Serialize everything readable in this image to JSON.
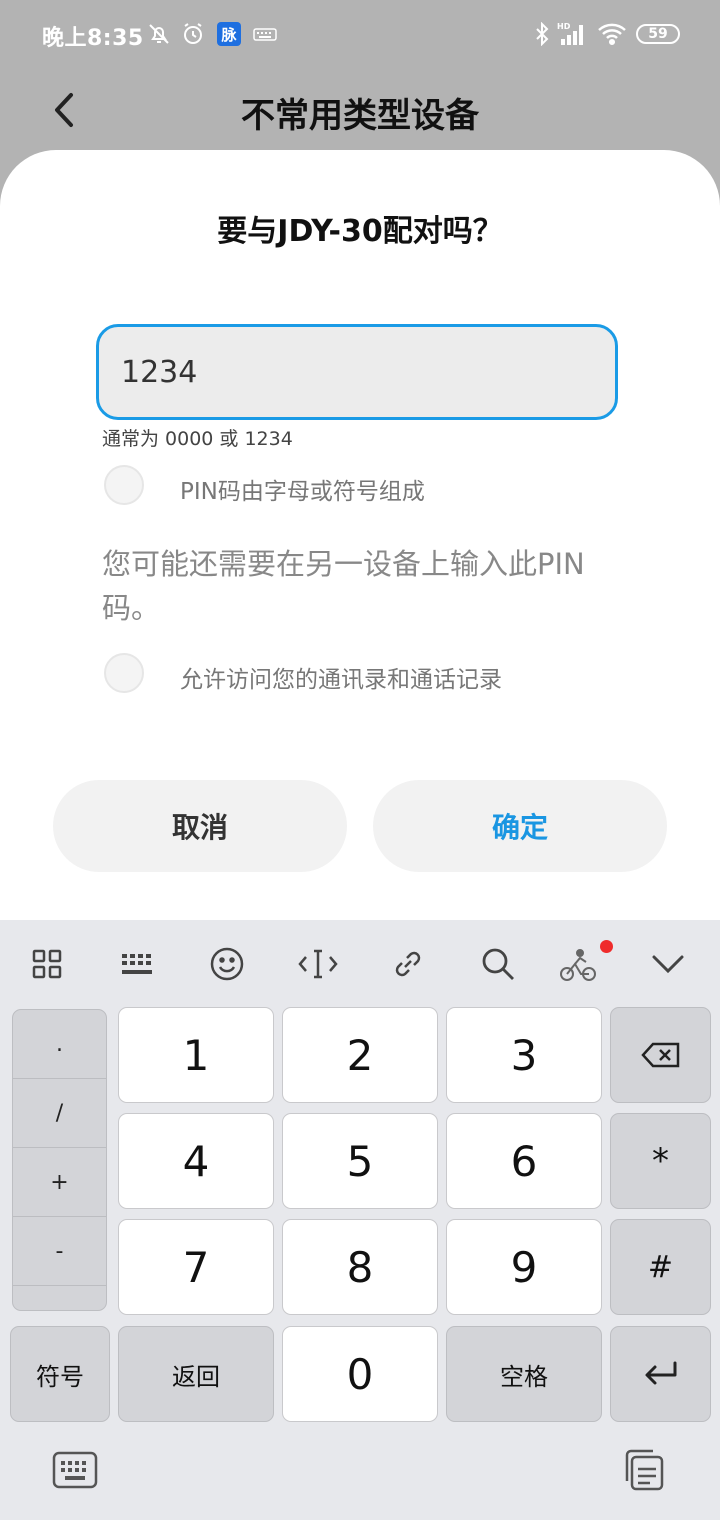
{
  "status_bar": {
    "time": "晚上8:35",
    "app_badge": "脉",
    "battery": "59",
    "icons": [
      "mute-bell-icon",
      "alarm-icon",
      "app-badge-icon",
      "keyboard-icon",
      "bluetooth-icon",
      "hd-signal-icon",
      "wifi-icon",
      "battery-icon"
    ]
  },
  "header": {
    "title": "不常用类型设备",
    "back_icon": "chevron-left-icon"
  },
  "dialog": {
    "title": "要与JDY-30配对吗？",
    "pin_value": "1234",
    "hint": "通常为 0000 或 1234",
    "option_alnum_label": "PIN码由字母或符号组成",
    "info_text": "您可能还需要在另一设备上输入此PIN码。",
    "option_contacts_label": "允许访问您的通讯录和通话记录",
    "cancel_label": "取消",
    "confirm_label": "确定",
    "confirm_color": "#1a96e2"
  },
  "keyboard": {
    "toolbar_icons": [
      "grid-icon",
      "keyboard-layout-icon",
      "emoji-icon",
      "cursor-icon",
      "link-icon",
      "search-icon",
      "cyclist-icon",
      "chevron-down-icon"
    ],
    "symbol_column": [
      ".",
      "/",
      "+",
      "-",
      ""
    ],
    "digits": [
      "1",
      "2",
      "3",
      "4",
      "5",
      "6",
      "7",
      "8",
      "9"
    ],
    "zero": "0",
    "right_keys": [
      "⌫",
      "*",
      "#"
    ],
    "bottom_row": {
      "symbols": "符号",
      "back": "返回",
      "space": "空格"
    },
    "bottom_icons": [
      "keyboard-switch-icon",
      "clipboard-icon"
    ]
  }
}
